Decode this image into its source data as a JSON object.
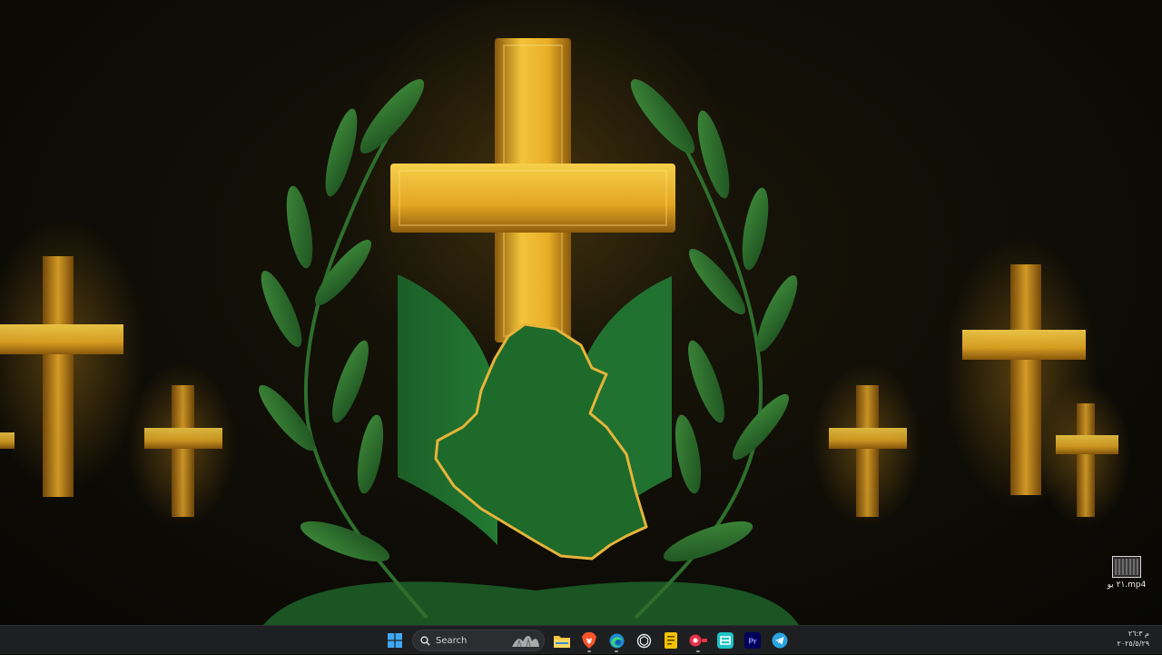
{
  "desktop": {
    "icons": [
      {
        "label": "٢١ یو.mp4",
        "icon": "video-file-icon"
      }
    ]
  },
  "taskbar": {
    "search": {
      "placeholder": "Search"
    },
    "apps": [
      {
        "name": "start",
        "icon": "windows-start-icon"
      },
      {
        "name": "file-explorer",
        "icon": "folder-icon"
      },
      {
        "name": "brave",
        "icon": "brave-lion-icon"
      },
      {
        "name": "edge",
        "icon": "edge-icon"
      },
      {
        "name": "chatgpt",
        "icon": "openai-icon"
      },
      {
        "name": "notes",
        "icon": "notes-icon"
      },
      {
        "name": "screen-recorder",
        "icon": "record-icon"
      },
      {
        "name": "capcut",
        "icon": "capcut-icon"
      },
      {
        "name": "premiere-pro",
        "icon": "premiere-pro-icon",
        "text": "Pr"
      },
      {
        "name": "telegram",
        "icon": "telegram-icon"
      }
    ],
    "clock": {
      "time": "م ٢٦:٣",
      "date": "٢٠٢٥/٥/٢٩"
    }
  },
  "colors": {
    "gold": "#e0a82a",
    "green": "#1f6b2c",
    "taskbar": "#1e1f21"
  }
}
